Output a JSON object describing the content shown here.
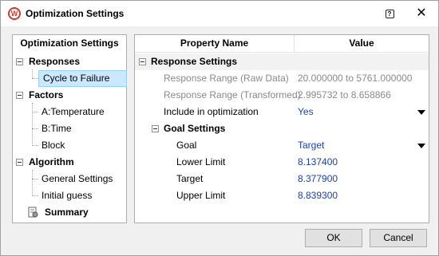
{
  "window": {
    "title": "Optimization Settings",
    "app_icon_letter": "W",
    "help_icon": "help-icon",
    "close_icon": "close-icon"
  },
  "tree": {
    "header": "Optimization Settings",
    "groups": [
      {
        "label": "Responses",
        "items": [
          "Cycle to Failure"
        ]
      },
      {
        "label": "Factors",
        "items": [
          "A:Temperature",
          "B:Time",
          "Block"
        ]
      },
      {
        "label": "Algorithm",
        "items": [
          "General Settings",
          "Initial guess"
        ]
      }
    ],
    "summary_label": "Summary",
    "selected_item": "Cycle to Failure"
  },
  "grid": {
    "col_property": "Property Name",
    "col_value": "Value",
    "response_settings": "Response Settings",
    "rows": [
      {
        "name": "Response Range (Raw Data)",
        "value": "20.000000 to 5761.000000"
      },
      {
        "name": "Response Range (Transformed)",
        "value": "2.995732 to 8.658866"
      },
      {
        "name": "Include in optimization",
        "value": "Yes"
      }
    ],
    "goal_settings": "Goal Settings",
    "goal_rows": [
      {
        "name": "Goal",
        "value": "Target"
      },
      {
        "name": "Lower Limit",
        "value": "8.137400"
      },
      {
        "name": "Target",
        "value": "8.377900"
      },
      {
        "name": "Upper Limit",
        "value": "8.839300"
      }
    ]
  },
  "buttons": {
    "ok": "OK",
    "cancel": "Cancel"
  }
}
